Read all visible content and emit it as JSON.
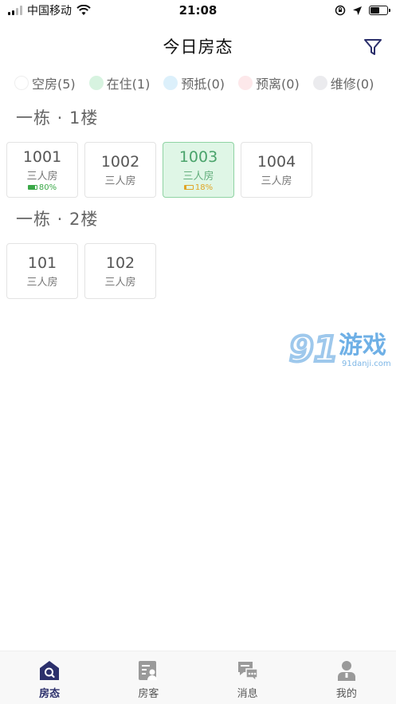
{
  "status_bar": {
    "carrier": "中国移动",
    "time": "21:08"
  },
  "header": {
    "title": "今日房态"
  },
  "legend": [
    {
      "label": "空房(5)",
      "color": "#ffffff"
    },
    {
      "label": "在住(1)",
      "color": "#d7f3e0"
    },
    {
      "label": "预抵(0)",
      "color": "#dcf0fb"
    },
    {
      "label": "预离(0)",
      "color": "#fde8ea"
    },
    {
      "label": "维修(0)",
      "color": "#ebebee"
    }
  ],
  "sections": [
    {
      "title": "一栋 · 1楼",
      "rooms": [
        {
          "number": "1001",
          "type": "三人房",
          "battery": "80%",
          "battery_level": 0.8,
          "occupied": false
        },
        {
          "number": "1002",
          "type": "三人房",
          "occupied": false
        },
        {
          "number": "1003",
          "type": "三人房",
          "battery": "18%",
          "battery_level": 0.18,
          "occupied": true
        },
        {
          "number": "1004",
          "type": "三人房",
          "occupied": false
        }
      ]
    },
    {
      "title": "一栋 · 2楼",
      "rooms": [
        {
          "number": "101",
          "type": "三人房",
          "occupied": false
        },
        {
          "number": "102",
          "type": "三人房",
          "occupied": false
        }
      ]
    }
  ],
  "watermark": {
    "number": "91",
    "text": "游戏",
    "url": "91danji.com"
  },
  "tabbar": [
    {
      "label": "房态",
      "icon": "house-search-icon",
      "active": true
    },
    {
      "label": "房客",
      "icon": "guest-card-icon",
      "active": false
    },
    {
      "label": "消息",
      "icon": "message-icon",
      "active": false
    },
    {
      "label": "我的",
      "icon": "user-icon",
      "active": false
    }
  ],
  "colors": {
    "accent": "#2b2f6b",
    "occupied_bg": "#dff6e6",
    "occupied_text": "#4aa36b",
    "battery_good": "#3aa847",
    "battery_low": "#e0a526"
  }
}
